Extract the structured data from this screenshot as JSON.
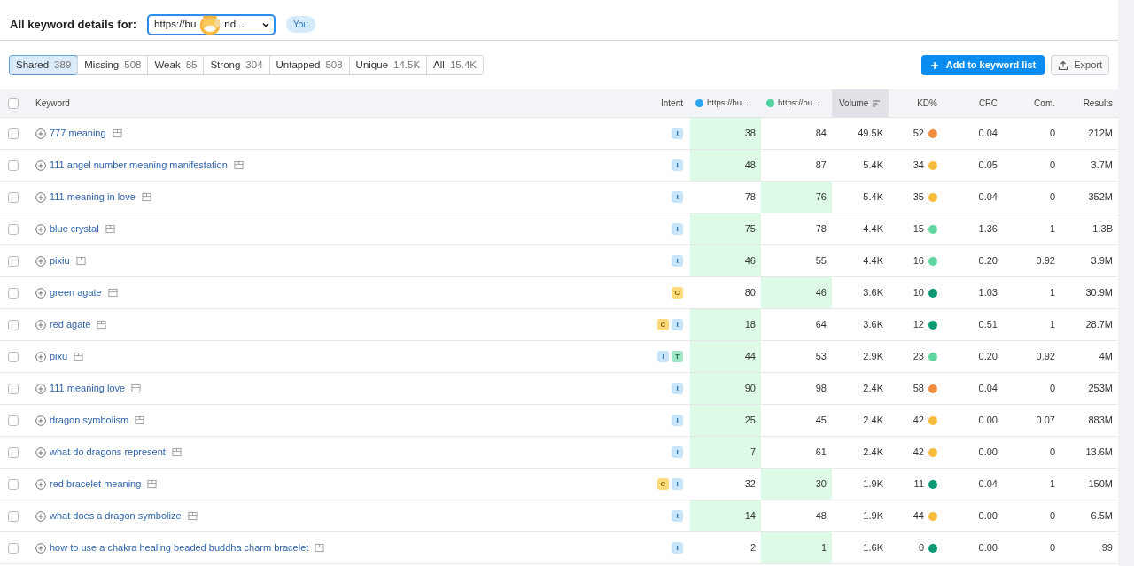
{
  "header": {
    "title": "All keyword details for:",
    "domain_select": {
      "value_parts": [
        "https://bu",
        "nd..."
      ]
    },
    "badge": "You"
  },
  "filter_tabs": [
    {
      "label": "Shared",
      "count": "389",
      "selected": true
    },
    {
      "label": "Missing",
      "count": "508",
      "selected": false
    },
    {
      "label": "Weak",
      "count": "85",
      "selected": false
    },
    {
      "label": "Strong",
      "count": "304",
      "selected": false
    },
    {
      "label": "Untapped",
      "count": "508",
      "selected": false
    },
    {
      "label": "Unique",
      "count": "14.5K",
      "selected": false
    },
    {
      "label": "All",
      "count": "15.4K",
      "selected": false
    }
  ],
  "actions": {
    "add": "Add to keyword list",
    "export": "Export"
  },
  "table": {
    "select_all_checked": false,
    "columns": {
      "keyword": "Keyword",
      "intent": "Intent",
      "site_1": {
        "label": "https://bu...",
        "color": "#2ea3f2"
      },
      "site_2": {
        "label": "https://bu...",
        "color": "#4fd1a0"
      },
      "volume": "Volume",
      "kd": "KD%",
      "cpc": "CPC",
      "com": "Com.",
      "results": "Results"
    },
    "rows": [
      {
        "checked": false,
        "keyword": "777 meaning",
        "intent": [
          {
            "kind": "informational",
            "label": "I"
          }
        ],
        "site_1": {
          "value": "38",
          "highlighted": true
        },
        "site_2": {
          "value": "84",
          "highlighted": false
        },
        "volume": "49.5K",
        "kd": {
          "value": "52",
          "color": "#f28c40"
        },
        "cpc": "0.04",
        "com": "0",
        "results": "212M"
      },
      {
        "checked": false,
        "keyword": "111 angel number meaning manifestation",
        "intent": [
          {
            "kind": "informational",
            "label": "I"
          }
        ],
        "site_1": {
          "value": "48",
          "highlighted": true
        },
        "site_2": {
          "value": "87",
          "highlighted": false
        },
        "volume": "5.4K",
        "kd": {
          "value": "34",
          "color": "#f7bc3c"
        },
        "cpc": "0.05",
        "com": "0",
        "results": "3.7M"
      },
      {
        "checked": false,
        "keyword": "111 meaning in love",
        "intent": [
          {
            "kind": "informational",
            "label": "I"
          }
        ],
        "site_1": {
          "value": "78",
          "highlighted": false
        },
        "site_2": {
          "value": "76",
          "highlighted": true
        },
        "volume": "5.4K",
        "kd": {
          "value": "35",
          "color": "#f7bc3c"
        },
        "cpc": "0.04",
        "com": "0",
        "results": "352M"
      },
      {
        "checked": false,
        "keyword": "blue crystal",
        "intent": [
          {
            "kind": "informational",
            "label": "I"
          }
        ],
        "site_1": {
          "value": "75",
          "highlighted": true
        },
        "site_2": {
          "value": "78",
          "highlighted": false
        },
        "volume": "4.4K",
        "kd": {
          "value": "15",
          "color": "#5fd6a0"
        },
        "cpc": "1.36",
        "com": "1",
        "results": "1.3B"
      },
      {
        "checked": false,
        "keyword": "pixiu",
        "intent": [
          {
            "kind": "informational",
            "label": "I"
          }
        ],
        "site_1": {
          "value": "46",
          "highlighted": true
        },
        "site_2": {
          "value": "55",
          "highlighted": false
        },
        "volume": "4.4K",
        "kd": {
          "value": "16",
          "color": "#5fd6a0"
        },
        "cpc": "0.20",
        "com": "0.92",
        "results": "3.9M"
      },
      {
        "checked": false,
        "keyword": "green agate",
        "intent": [
          {
            "kind": "commercial",
            "label": "C"
          }
        ],
        "site_1": {
          "value": "80",
          "highlighted": false
        },
        "site_2": {
          "value": "46",
          "highlighted": true
        },
        "volume": "3.6K",
        "kd": {
          "value": "10",
          "color": "#0b9a73"
        },
        "cpc": "1.03",
        "com": "1",
        "results": "30.9M"
      },
      {
        "checked": false,
        "keyword": "red agate",
        "intent": [
          {
            "kind": "commercial",
            "label": "C"
          },
          {
            "kind": "informational",
            "label": "I"
          }
        ],
        "site_1": {
          "value": "18",
          "highlighted": true
        },
        "site_2": {
          "value": "64",
          "highlighted": false
        },
        "volume": "3.6K",
        "kd": {
          "value": "12",
          "color": "#0b9a73"
        },
        "cpc": "0.51",
        "com": "1",
        "results": "28.7M"
      },
      {
        "checked": false,
        "keyword": "pixu",
        "intent": [
          {
            "kind": "informational",
            "label": "I"
          },
          {
            "kind": "transactional",
            "label": "T"
          }
        ],
        "site_1": {
          "value": "44",
          "highlighted": true
        },
        "site_2": {
          "value": "53",
          "highlighted": false
        },
        "volume": "2.9K",
        "kd": {
          "value": "23",
          "color": "#5fd6a0"
        },
        "cpc": "0.20",
        "com": "0.92",
        "results": "4M"
      },
      {
        "checked": false,
        "keyword": "111 meaning love",
        "intent": [
          {
            "kind": "informational",
            "label": "I"
          }
        ],
        "site_1": {
          "value": "90",
          "highlighted": true
        },
        "site_2": {
          "value": "98",
          "highlighted": false
        },
        "volume": "2.4K",
        "kd": {
          "value": "58",
          "color": "#f28c40"
        },
        "cpc": "0.04",
        "com": "0",
        "results": "253M"
      },
      {
        "checked": false,
        "keyword": "dragon symbolism",
        "intent": [
          {
            "kind": "informational",
            "label": "I"
          }
        ],
        "site_1": {
          "value": "25",
          "highlighted": true
        },
        "site_2": {
          "value": "45",
          "highlighted": false
        },
        "volume": "2.4K",
        "kd": {
          "value": "42",
          "color": "#f7bc3c"
        },
        "cpc": "0.00",
        "com": "0.07",
        "results": "883M"
      },
      {
        "checked": false,
        "keyword": "what do dragons represent",
        "intent": [
          {
            "kind": "informational",
            "label": "I"
          }
        ],
        "site_1": {
          "value": "7",
          "highlighted": true
        },
        "site_2": {
          "value": "61",
          "highlighted": false
        },
        "volume": "2.4K",
        "kd": {
          "value": "42",
          "color": "#f7bc3c"
        },
        "cpc": "0.00",
        "com": "0",
        "results": "13.6M"
      },
      {
        "checked": false,
        "keyword": "red bracelet meaning",
        "intent": [
          {
            "kind": "commercial",
            "label": "C"
          },
          {
            "kind": "informational",
            "label": "I"
          }
        ],
        "site_1": {
          "value": "32",
          "highlighted": false
        },
        "site_2": {
          "value": "30",
          "highlighted": true
        },
        "volume": "1.9K",
        "kd": {
          "value": "11",
          "color": "#0b9a73"
        },
        "cpc": "0.04",
        "com": "1",
        "results": "150M"
      },
      {
        "checked": false,
        "keyword": "what does a dragon symbolize",
        "intent": [
          {
            "kind": "informational",
            "label": "I"
          }
        ],
        "site_1": {
          "value": "14",
          "highlighted": true
        },
        "site_2": {
          "value": "48",
          "highlighted": false
        },
        "volume": "1.9K",
        "kd": {
          "value": "44",
          "color": "#f7bc3c"
        },
        "cpc": "0.00",
        "com": "0",
        "results": "6.5M"
      },
      {
        "checked": false,
        "keyword": "how to use a chakra healing beaded buddha charm bracelet",
        "intent": [
          {
            "kind": "informational",
            "label": "I"
          }
        ],
        "site_1": {
          "value": "2",
          "highlighted": false
        },
        "site_2": {
          "value": "1",
          "highlighted": true
        },
        "volume": "1.6K",
        "kd": {
          "value": "0",
          "color": "#0b9a73"
        },
        "cpc": "0.00",
        "com": "0",
        "results": "99"
      }
    ]
  }
}
